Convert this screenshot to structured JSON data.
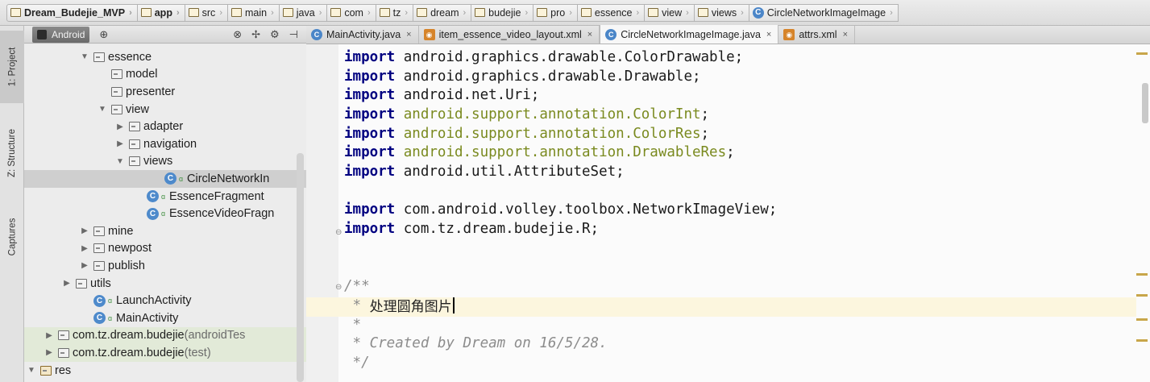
{
  "breadcrumb": [
    {
      "label": "Dream_Budejie_MVP",
      "icon": "project-folder-icon",
      "bold": true
    },
    {
      "label": "app",
      "icon": "module-folder-icon",
      "bold": true
    },
    {
      "label": "src",
      "icon": "folder-icon"
    },
    {
      "label": "main",
      "icon": "folder-icon"
    },
    {
      "label": "java",
      "icon": "folder-icon"
    },
    {
      "label": "com",
      "icon": "package-icon"
    },
    {
      "label": "tz",
      "icon": "package-icon"
    },
    {
      "label": "dream",
      "icon": "package-icon"
    },
    {
      "label": "budejie",
      "icon": "package-icon"
    },
    {
      "label": "pro",
      "icon": "package-icon"
    },
    {
      "label": "essence",
      "icon": "package-icon"
    },
    {
      "label": "view",
      "icon": "package-icon"
    },
    {
      "label": "views",
      "icon": "package-icon"
    },
    {
      "label": "CircleNetworkImageImage",
      "icon": "class-icon"
    }
  ],
  "tool_windows": {
    "project": "1: Project",
    "structure": "Z: Structure",
    "captures": "Captures"
  },
  "project_panel": {
    "view_mode": "Android",
    "tree": [
      {
        "label": "essence",
        "type": "package",
        "indent": 4,
        "arrow": "▼"
      },
      {
        "label": "model",
        "type": "package",
        "indent": 5,
        "arrow": ""
      },
      {
        "label": "presenter",
        "type": "package",
        "indent": 5,
        "arrow": ""
      },
      {
        "label": "view",
        "type": "package",
        "indent": 5,
        "arrow": "▼"
      },
      {
        "label": "adapter",
        "type": "package",
        "indent": 6,
        "arrow": "▶"
      },
      {
        "label": "navigation",
        "type": "package",
        "indent": 6,
        "arrow": "▶"
      },
      {
        "label": "views",
        "type": "package",
        "indent": 6,
        "arrow": "▼"
      },
      {
        "label": "CircleNetworkIn",
        "type": "class",
        "indent": 8,
        "arrow": "",
        "selected": true
      },
      {
        "label": "EssenceFragment",
        "type": "class",
        "indent": 7,
        "arrow": ""
      },
      {
        "label": "EssenceVideoFragn",
        "type": "class",
        "indent": 7,
        "arrow": ""
      },
      {
        "label": "mine",
        "type": "package",
        "indent": 4,
        "arrow": "▶"
      },
      {
        "label": "newpost",
        "type": "package",
        "indent": 4,
        "arrow": "▶"
      },
      {
        "label": "publish",
        "type": "package",
        "indent": 4,
        "arrow": "▶"
      },
      {
        "label": "utils",
        "type": "package",
        "indent": 3,
        "arrow": "▶"
      },
      {
        "label": "LaunchActivity",
        "type": "class",
        "indent": 4,
        "arrow": ""
      },
      {
        "label": "MainActivity",
        "type": "class",
        "indent": 4,
        "arrow": ""
      },
      {
        "label": "com.tz.dream.budejie",
        "suffix": " (androidTes",
        "type": "package",
        "indent": 2,
        "arrow": "▶",
        "tinted": true
      },
      {
        "label": "com.tz.dream.budejie",
        "suffix": " (test)",
        "type": "package",
        "indent": 2,
        "arrow": "▶",
        "tinted": true
      },
      {
        "label": "res",
        "type": "res",
        "indent": 1,
        "arrow": "▼"
      }
    ]
  },
  "tabs": [
    {
      "label": "MainActivity.java",
      "kind": "java",
      "active": false
    },
    {
      "label": "item_essence_video_layout.xml",
      "kind": "xml",
      "active": false
    },
    {
      "label": "CircleNetworkImageImage.java",
      "kind": "java",
      "active": true
    },
    {
      "label": "attrs.xml",
      "kind": "xml",
      "active": false
    }
  ],
  "code": [
    {
      "kw": "import",
      "rest": " android.graphics.drawable.ColorDrawable;",
      "style": "plain"
    },
    {
      "kw": "import",
      "rest": " android.graphics.drawable.Drawable;",
      "style": "plain"
    },
    {
      "kw": "import",
      "rest": " android.net.Uri;",
      "style": "plain"
    },
    {
      "kw": "import",
      "pre": " ",
      "rest": "android.support.annotation.ColorInt",
      "post": ";",
      "style": "ann"
    },
    {
      "kw": "import",
      "pre": " ",
      "rest": "android.support.annotation.ColorRes",
      "post": ";",
      "style": "ann"
    },
    {
      "kw": "import",
      "pre": " ",
      "rest": "android.support.annotation.DrawableRes",
      "post": ";",
      "style": "ann"
    },
    {
      "kw": "import",
      "rest": " android.util.AttributeSet;",
      "style": "plain"
    },
    {
      "kw": "",
      "rest": "",
      "style": "plain"
    },
    {
      "kw": "import",
      "rest": " com.android.volley.toolbox.NetworkImageView;",
      "style": "plain"
    },
    {
      "kw": "import",
      "rest": " com.tz.dream.budejie.R;",
      "style": "plain"
    },
    {
      "kw": "",
      "rest": "",
      "style": "plain"
    },
    {
      "kw": "",
      "rest": "",
      "style": "plain"
    },
    {
      "kw": "",
      "rest": "/**",
      "style": "cmt"
    },
    {
      "kw": "",
      "rest": " * ",
      "cn": "处理圆角图片",
      "style": "cmt",
      "caret": true
    },
    {
      "kw": "",
      "rest": " *",
      "style": "cmt"
    },
    {
      "kw": "",
      "rest": " * Created by Dream on 16/5/28.",
      "style": "cmt"
    },
    {
      "kw": "",
      "rest": " */",
      "style": "cmt"
    }
  ]
}
